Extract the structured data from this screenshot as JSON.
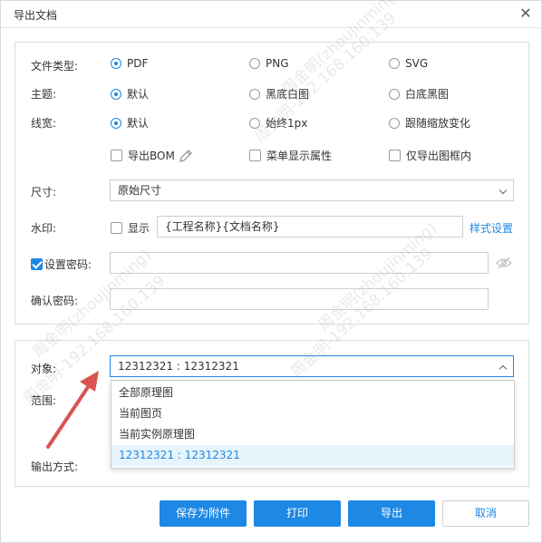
{
  "dialog": {
    "title": "导出文档"
  },
  "labels": {
    "file_type": "文件类型:",
    "theme": "主题:",
    "line_width": "线宽:",
    "size": "尺寸:",
    "watermark": "水印:",
    "set_password": "设置密码:",
    "confirm_password": "确认密码:",
    "object": "对象:",
    "scope": "范围:",
    "output_method": "输出方式:"
  },
  "file_type": {
    "options": [
      "PDF",
      "PNG",
      "SVG"
    ],
    "selected": "PDF"
  },
  "theme": {
    "options": [
      "默认",
      "黑底白图",
      "白底黑图"
    ],
    "selected": "默认"
  },
  "line_width": {
    "options": [
      "默认",
      "始终1px",
      "跟随缩放变化"
    ],
    "selected": "默认"
  },
  "extras": [
    {
      "label": "导出BOM",
      "checked": false
    },
    {
      "label": "菜单显示属性",
      "checked": false
    },
    {
      "label": "仅导出图框内",
      "checked": false
    }
  ],
  "size": {
    "value": "原始尺寸"
  },
  "watermark": {
    "show_label": "显示",
    "show_checked": false,
    "text": "{工程名称}{文档名称}",
    "style_link": "样式设置"
  },
  "password": {
    "checked": true,
    "value": "",
    "confirm_value": ""
  },
  "object": {
    "value": "12312321 : 12312321",
    "options": [
      "全部原理图",
      "当前图页",
      "当前实例原理图",
      "12312321 : 12312321"
    ],
    "selected_index": 3
  },
  "buttons": {
    "save_attachment": "保存为附件",
    "print": "打印",
    "export": "导出",
    "cancel": "取消"
  },
  "watermark_overlay": {
    "name": "周金明(zhoujinming)",
    "ip": "周金明-192.168.160.139"
  },
  "colors": {
    "accent": "#1e88e5",
    "arrow": "#d9534f"
  }
}
